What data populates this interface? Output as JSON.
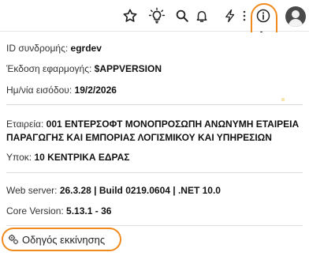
{
  "toolbar": {
    "icons": [
      "star-icon",
      "lightbulb-icon",
      "search-icon",
      "bell-icon",
      "bolt-icon",
      "more-vertical-icon",
      "info-icon"
    ],
    "highlight_color": "#f08a1c"
  },
  "info": {
    "subscription_label": "ID συνδρομής:",
    "subscription_value": "egrdev",
    "version_label": "Έκδοση εφαρμογής:",
    "version_value": "$APPVERSION",
    "login_label": "Ημ/νία εισόδου:",
    "login_value": "19/2/2026",
    "company_label": "Εταιρεία:",
    "company_value": "001 ΕΝΤΕΡΣΟΦΤ ΜΟΝΟΠΡΟΣΩΠΗ ΑΝΩΝΥΜΗ ΕΤΑΙΡΕΙΑ ΠΑΡΑΓΩΓΗΣ ΚΑΙ ΕΜΠΟΡΙΑΣ ΛΟΓΙΣΜΙΚΟΥ ΚΑΙ ΥΠΗΡΕΣΙΩΝ",
    "branch_label": "Υποκ:",
    "branch_value": "10 ΚΕΝΤΡΙΚΑ ΕΔΡΑΣ",
    "webserver_label": "Web server:",
    "webserver_value": "26.3.28 | Build 0219.0604 | .NET 10.0",
    "core_label": "Core Version:",
    "core_value": "5.13.1 - 36"
  },
  "guide": {
    "label": "Οδηγός εκκίνησης"
  }
}
